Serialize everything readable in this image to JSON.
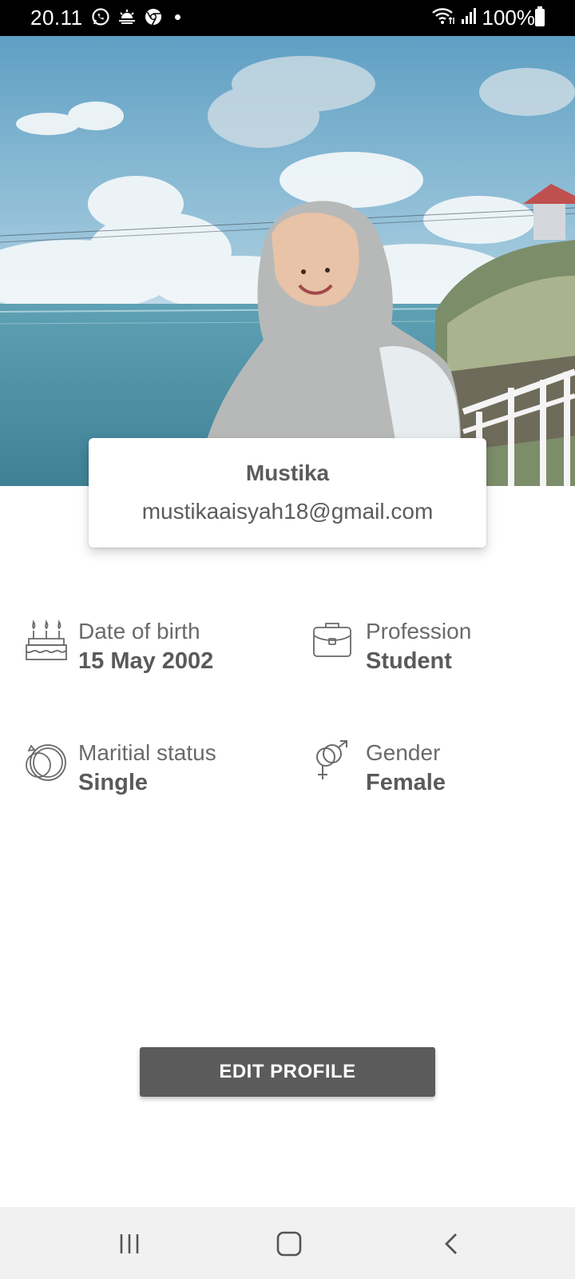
{
  "status_bar": {
    "time": "20.11",
    "battery": "100%",
    "icons": [
      "whatsapp-icon",
      "weather-icon",
      "chrome-icon",
      "wifi-icon",
      "signal-icon",
      "battery-icon"
    ]
  },
  "cover": {
    "description_icon": "cover-photo"
  },
  "profile": {
    "name": "Mustika",
    "email": "mustikaaisyah18@gmail.com"
  },
  "info": {
    "dob": {
      "label": "Date of birth",
      "value": "15 May 2002",
      "icon": "birthday-cake-icon"
    },
    "profession": {
      "label": "Profession",
      "value": "Student",
      "icon": "briefcase-icon"
    },
    "marital": {
      "label": "Maritial status",
      "value": "Single",
      "icon": "rings-icon"
    },
    "gender": {
      "label": "Gender",
      "value": "Female",
      "icon": "gender-icon"
    }
  },
  "actions": {
    "edit_label": "EDIT PROFILE"
  },
  "nav": {
    "items": [
      "recent-apps-icon",
      "home-icon",
      "back-icon"
    ]
  },
  "colors": {
    "status_bar": "#000000",
    "button": "#5b5b5b",
    "text": "#5c5c5c",
    "nav_bar": "#f1f1f1"
  }
}
